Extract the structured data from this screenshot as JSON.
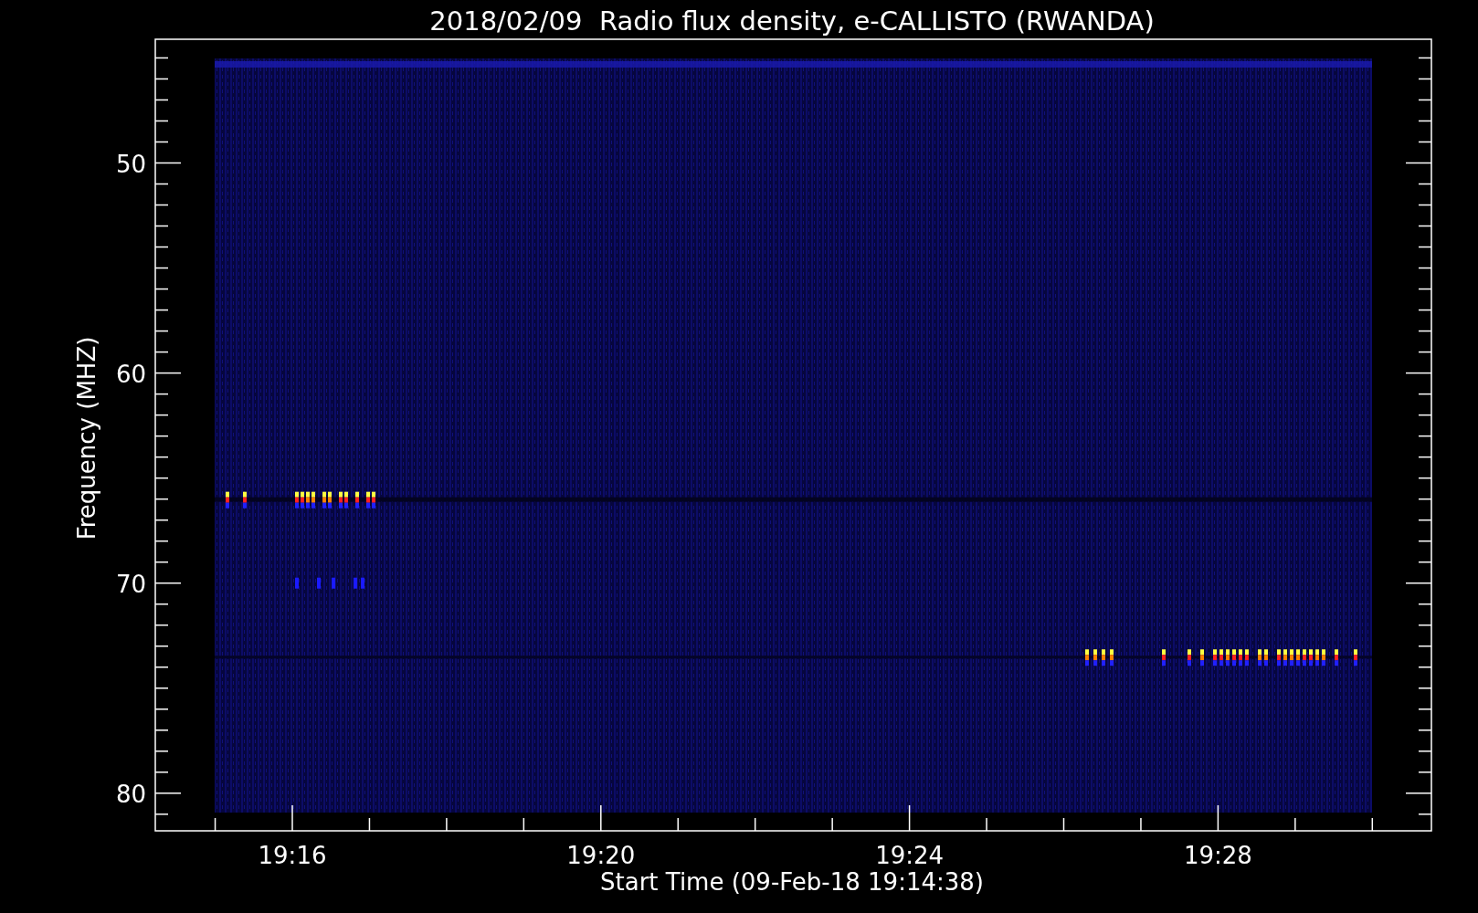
{
  "chart": {
    "title": "2018/02/09  Radio flux density, e-CALLISTO (RWANDA)",
    "xlabel": "Start Time (09-Feb-18 19:14:38)",
    "ylabel": "Frequency (MHZ)",
    "xtick_labels": [
      "19:16",
      "19:20",
      "19:24",
      "19:28"
    ],
    "ytick_labels": [
      "50",
      "60",
      "70",
      "80"
    ]
  }
}
